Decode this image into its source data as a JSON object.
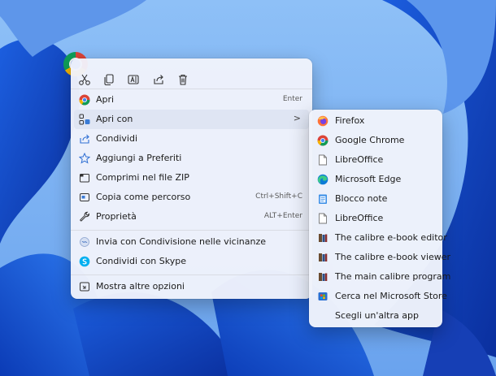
{
  "desktop": {
    "icon": "chrome-shortcut-icon"
  },
  "toolbar": {
    "icons": [
      "cut-icon",
      "copy-icon",
      "rename-icon",
      "share-icon",
      "delete-icon"
    ]
  },
  "menu": {
    "items": [
      {
        "label": "Apri",
        "shortcut": "Enter",
        "icon": "chrome-icon"
      },
      {
        "label": "Apri con",
        "icon": "open-with-icon",
        "submenu": true
      },
      {
        "label": "Condividi",
        "icon": "share-icon"
      },
      {
        "label": "Aggiungi a Preferiti",
        "icon": "star-icon"
      },
      {
        "label": "Comprimi nel file ZIP",
        "icon": "zip-icon"
      },
      {
        "label": "Copia come percorso",
        "shortcut": "Ctrl+Shift+C",
        "icon": "copy-path-icon"
      },
      {
        "label": "Proprietà",
        "shortcut": "ALT+Enter",
        "icon": "wrench-icon"
      },
      {
        "label": "Invia con Condivisione nelle vicinanze",
        "icon": "nearby-share-icon"
      },
      {
        "label": "Condividi con Skype",
        "icon": "skype-icon"
      },
      {
        "label": "Mostra altre opzioni",
        "icon": "more-options-icon"
      }
    ],
    "chevron": ">"
  },
  "submenu": {
    "items": [
      {
        "label": "Firefox",
        "icon": "firefox-icon"
      },
      {
        "label": "Google Chrome",
        "icon": "chrome-icon"
      },
      {
        "label": "LibreOffice",
        "icon": "file-icon"
      },
      {
        "label": "Microsoft Edge",
        "icon": "edge-icon"
      },
      {
        "label": "Blocco note",
        "icon": "notepad-icon"
      },
      {
        "label": "LibreOffice",
        "icon": "file-icon"
      },
      {
        "label": "The calibre e-book editor",
        "icon": "calibre-icon"
      },
      {
        "label": "The calibre e-book viewer",
        "icon": "calibre-icon"
      },
      {
        "label": "The main calibre program",
        "icon": "calibre-icon"
      },
      {
        "label": "Cerca nel Microsoft Store",
        "icon": "store-icon"
      },
      {
        "label": "Scegli un'altra app",
        "icon": ""
      }
    ]
  }
}
